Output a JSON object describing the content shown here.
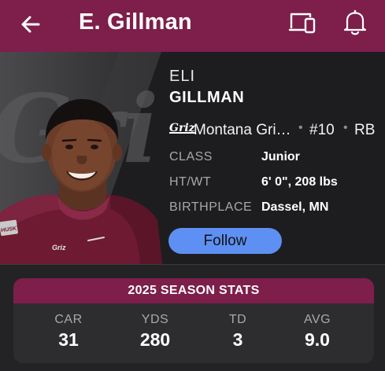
{
  "header": {
    "title": "E. Gillman",
    "back_icon": "arrow-left-icon",
    "device_icon": "devices-icon",
    "bell_icon": "bell-icon",
    "bar_color": "#7d1f4a"
  },
  "player": {
    "first_name": "ELI",
    "last_name": "GILLMAN",
    "team_logo_text": "Griz",
    "team": "Montana Gri…",
    "separator": "•",
    "jersey": "#10",
    "position": "RB",
    "jersey_text": "HUSKY",
    "info": [
      {
        "label": "CLASS",
        "value": "Junior"
      },
      {
        "label": "HT/WT",
        "value": "6' 0\", 208 lbs"
      },
      {
        "label": "BIRTHPLACE",
        "value": "Dassel, MN"
      }
    ],
    "follow_label": "Follow",
    "follow_color": "#5e8ff2"
  },
  "stats": {
    "title": "2025 SEASON STATS",
    "items": [
      {
        "label": "CAR",
        "value": "31"
      },
      {
        "label": "YDS",
        "value": "280"
      },
      {
        "label": "TD",
        "value": "3"
      },
      {
        "label": "AVG",
        "value": "9.0"
      }
    ]
  }
}
